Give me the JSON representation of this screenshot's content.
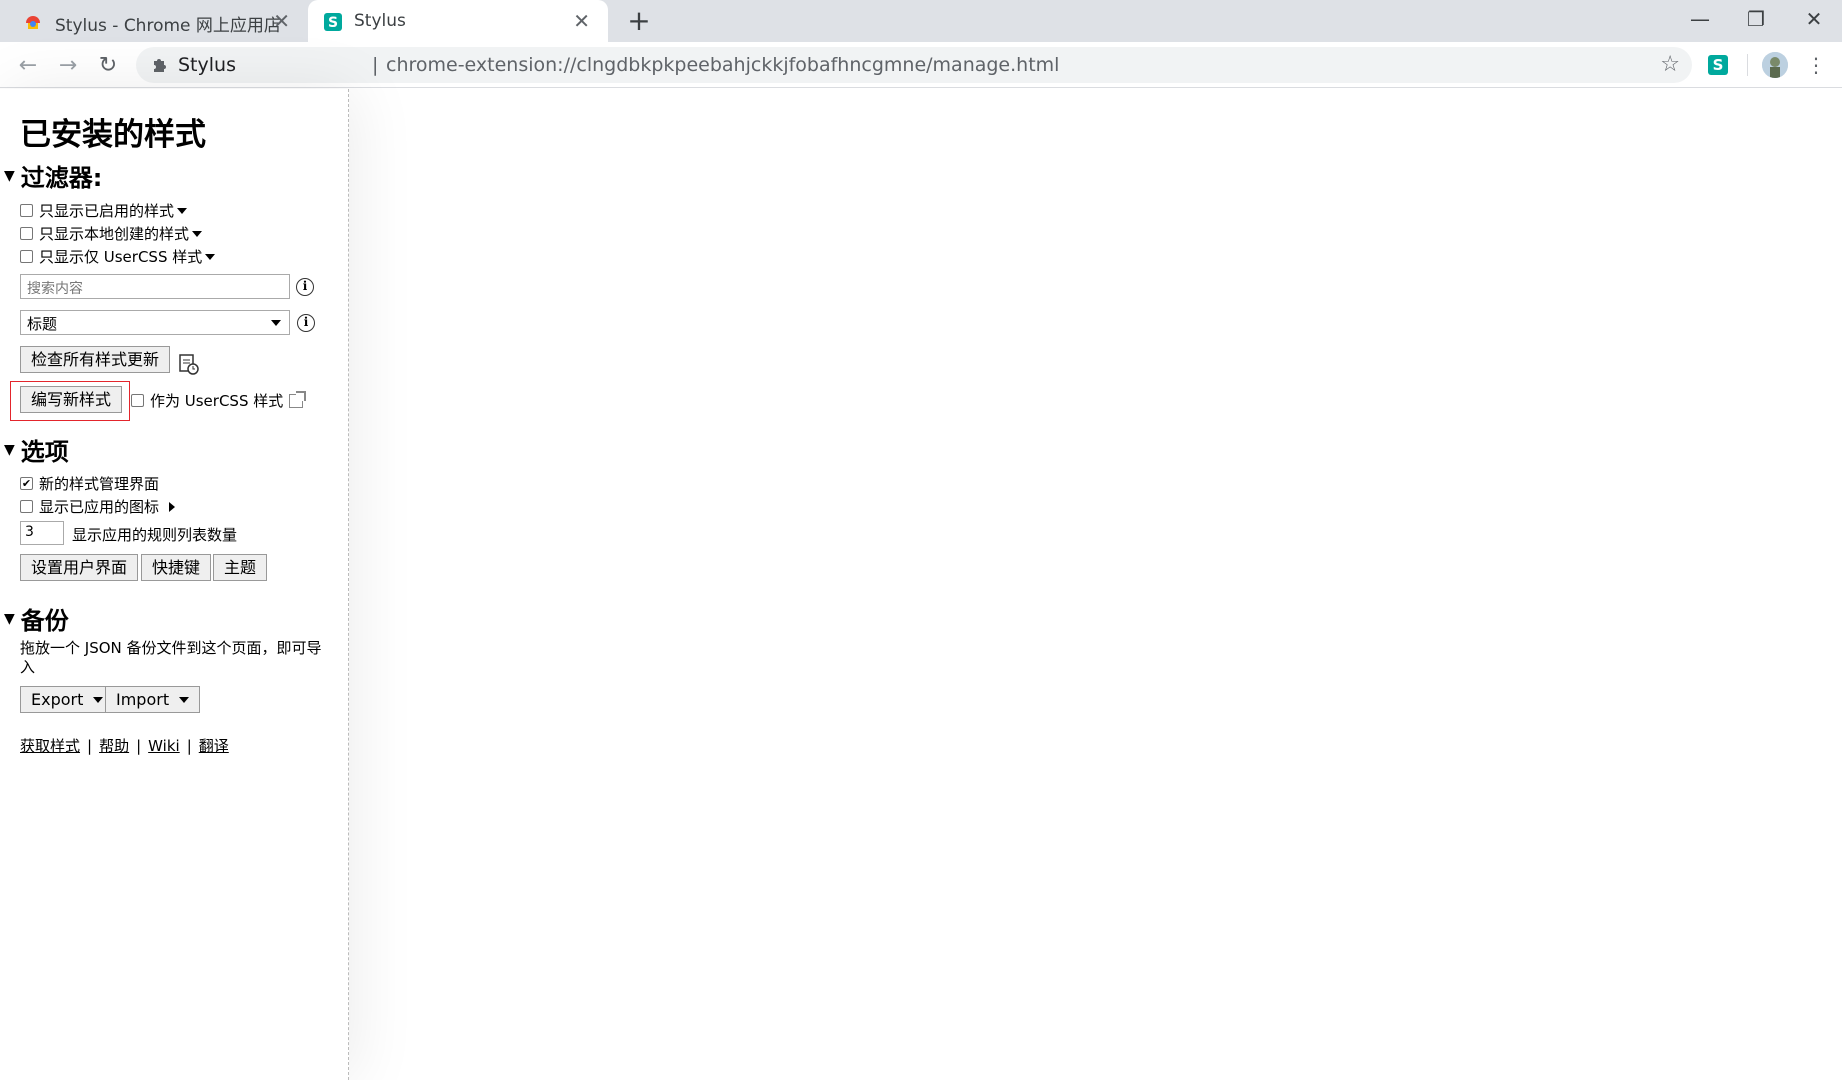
{
  "browser": {
    "tabs": [
      {
        "title": "Stylus - Chrome 网上应用店",
        "active": false,
        "icon": "webstore-icon"
      },
      {
        "title": "Stylus",
        "active": true,
        "icon": "stylus-icon"
      }
    ],
    "omnibox": {
      "site_name": "Stylus",
      "separator": "|",
      "url": "chrome-extension://clngdbkpkpeebahjckkjfobafhncgmne/manage.html"
    }
  },
  "sidebar": {
    "title": "已安装的样式",
    "filters": {
      "heading": "过滤器:",
      "checkboxes": [
        {
          "label": "只显示已启用的样式",
          "checked": false
        },
        {
          "label": "只显示本地创建的样式",
          "checked": false
        },
        {
          "label": "只显示仅 UserCSS 样式",
          "checked": false
        }
      ],
      "search_placeholder": "搜索内容",
      "sort_selected": "标题",
      "check_updates_label": "检查所有样式更新",
      "write_new_label": "编写新样式",
      "as_usercss_label": "作为 UserCSS 样式"
    },
    "options": {
      "heading": "选项",
      "checkboxes": [
        {
          "label": "新的样式管理界面",
          "checked": true
        },
        {
          "label": "显示已应用的图标",
          "checked": false
        }
      ],
      "rules_count": "3",
      "rules_count_label": "显示应用的规则列表数量",
      "buttons": [
        "设置用户界面",
        "快捷键",
        "主题"
      ]
    },
    "backup": {
      "heading": "备份",
      "text": "拖放一个 JSON 备份文件到这个页面，即可导入",
      "export_label": "Export",
      "import_label": "Import"
    },
    "links": [
      "获取样式",
      "帮助",
      "Wiki",
      "翻译"
    ]
  },
  "colors": {
    "tabstrip_bg": "#dee1e6",
    "highlight_border": "#e3252c",
    "stylus_brand": "#00a99d"
  }
}
